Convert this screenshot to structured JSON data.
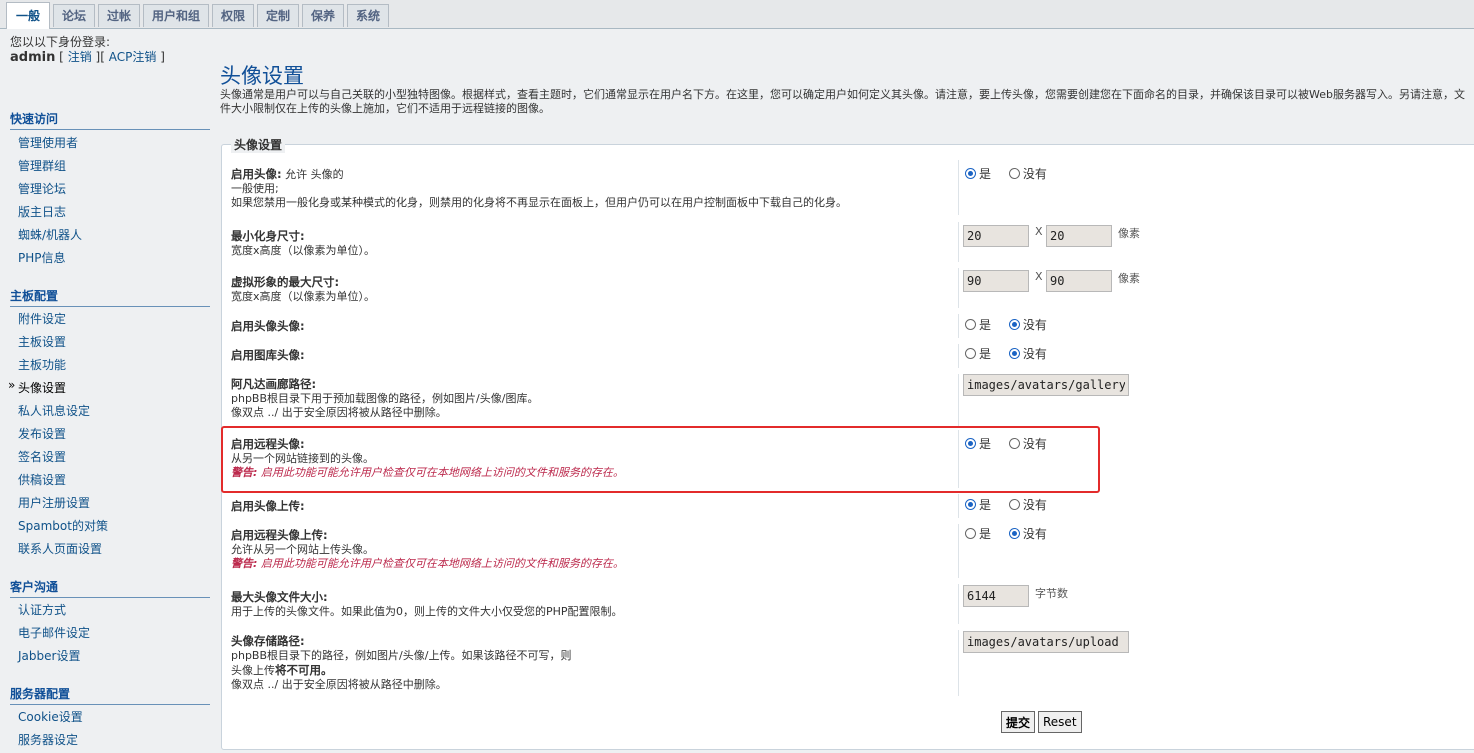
{
  "tabs": [
    {
      "label": "一般",
      "active": true
    },
    {
      "label": "论坛"
    },
    {
      "label": "过帐"
    },
    {
      "label": "用户和组"
    },
    {
      "label": "权限"
    },
    {
      "label": "定制"
    },
    {
      "label": "保养"
    },
    {
      "label": "系统"
    }
  ],
  "login": {
    "label": "您以以下身份登录:",
    "user": "admin",
    "logout": "注销",
    "acp_logout": "ACP注销",
    "bracket_open": "[",
    "bracket_close": "]"
  },
  "sidebar": {
    "quick": {
      "title": "快速访问",
      "items": [
        "管理使用者",
        "管理群组",
        "管理论坛",
        "版主日志",
        "蜘蛛/机器人",
        "PHP信息"
      ]
    },
    "board": {
      "title": "主板配置",
      "items": [
        "附件设定",
        "主板设置",
        "主板功能",
        "头像设置",
        "私人讯息设定",
        "发布设置",
        "签名设置",
        "供稿设置",
        "用户注册设置",
        "Spambot的对策",
        "联系人页面设置"
      ],
      "active": "头像设置"
    },
    "client": {
      "title": "客户沟通",
      "items": [
        "认证方式",
        "电子邮件设定",
        "Jabber设置"
      ]
    },
    "server": {
      "title": "服务器配置",
      "items": [
        "Cookie设置",
        "服务器设定"
      ]
    }
  },
  "page": {
    "title": "头像设置",
    "desc": "头像通常是用户可以与自己关联的小型独特图像。根据样式，查看主题时，它们通常显示在用户名下方。在这里，您可以确定用户如何定义其头像。请注意，要上传头像，您需要创建您在下面命名的目录，并确保该目录可以被Web服务器写入。另请注意，文件大小限制仅在上传的头像上施加，它们不适用于远程链接的图像。"
  },
  "form": {
    "legend": "头像设置",
    "yes": "是",
    "no": "没有",
    "x": "X",
    "px_unit": "像素",
    "bytes_unit": "字节数",
    "warning_key": "警告:",
    "warning_text": "启用此功能可能允许用户检查仅可在本地网络上访问的文件和服务的存在。",
    "enable_avatars": {
      "title": "启用头像:",
      "title_extra": "允许 头像的",
      "line2": "一般使用;",
      "line3": "如果您禁用一般化身或某种模式的化身，则禁用的化身将不再显示在面板上，但用户仍可以在用户控制面板中下载自己的化身。",
      "value": "yes"
    },
    "min_size": {
      "title": "最小化身尺寸:",
      "desc": "宽度x高度（以像素为单位）。",
      "width": "20",
      "height": "20"
    },
    "max_size": {
      "title": "虚拟形象的最大尺寸:",
      "desc": "宽度x高度（以像素为单位）。",
      "width": "90",
      "height": "90"
    },
    "enable_gallery_avatar": {
      "title": "启用头像头像:",
      "value": "no"
    },
    "enable_library_avatar": {
      "title": "启用图库头像:",
      "value": "no"
    },
    "gallery_path": {
      "title": "阿凡达画廊路径:",
      "line1": "phpBB根目录下用于预加载图像的路径，例如图片/头像/图库。",
      "line2": "像双点 ../ 出于安全原因将被从路径中删除。",
      "value": "images/avatars/gallery"
    },
    "enable_remote": {
      "title": "启用远程头像:",
      "desc": "从另一个网站链接到的头像。",
      "value": "yes"
    },
    "enable_upload": {
      "title": "启用头像上传:",
      "value": "yes"
    },
    "enable_remote_upload": {
      "title": "启用远程头像上传:",
      "desc": "允许从另一个网站上传头像。",
      "value": "no"
    },
    "max_filesize": {
      "title": "最大头像文件大小:",
      "desc": "用于上传的头像文件。如果此值为0，则上传的文件大小仅受您的PHP配置限制。",
      "value": "6144"
    },
    "storage_path": {
      "title": "头像存储路径:",
      "line1": "phpBB根目录下的路径，例如图片/头像/上传。如果该路径不可写，则",
      "line2a": "头像上传",
      "line2b": "将不可用。",
      "line3": "像双点 ../ 出于安全原因将被从路径中删除。",
      "value": "images/avatars/upload"
    },
    "submit": "提交",
    "reset": "Reset"
  }
}
